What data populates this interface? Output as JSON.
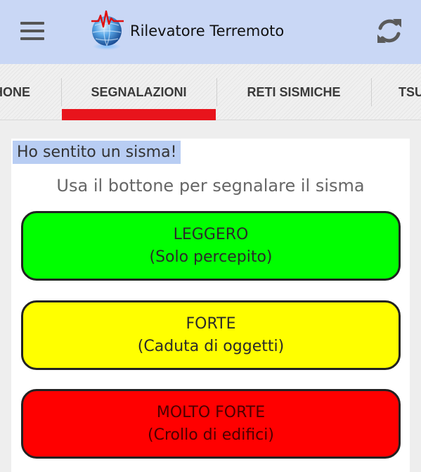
{
  "app": {
    "title": "Rilevatore Terremoto",
    "brand_color": "#c9d7f5"
  },
  "toolbar": {
    "menu_icon": "hamburger-menu-icon",
    "refresh_icon": "refresh-icon"
  },
  "tabs": {
    "items": [
      {
        "label": "HONE"
      },
      {
        "label": "SEGNALAZIONI",
        "selected": true
      },
      {
        "label": "RETI SISMICHE"
      },
      {
        "label": "TSU"
      }
    ],
    "indicator_color": "#e8141c"
  },
  "report": {
    "heard_label": "Ho sentito un sisma!",
    "instruction": "Usa il bottone per segnalare il sisma",
    "buttons": [
      {
        "title": "LEGGERO",
        "subtitle": "(Solo percepito)",
        "color": "#00ff00"
      },
      {
        "title": "FORTE",
        "subtitle": "(Caduta di oggetti)",
        "color": "#ffff00"
      },
      {
        "title": "MOLTO FORTE",
        "subtitle": "(Crollo di edifici)",
        "color": "#ff0000"
      }
    ]
  }
}
